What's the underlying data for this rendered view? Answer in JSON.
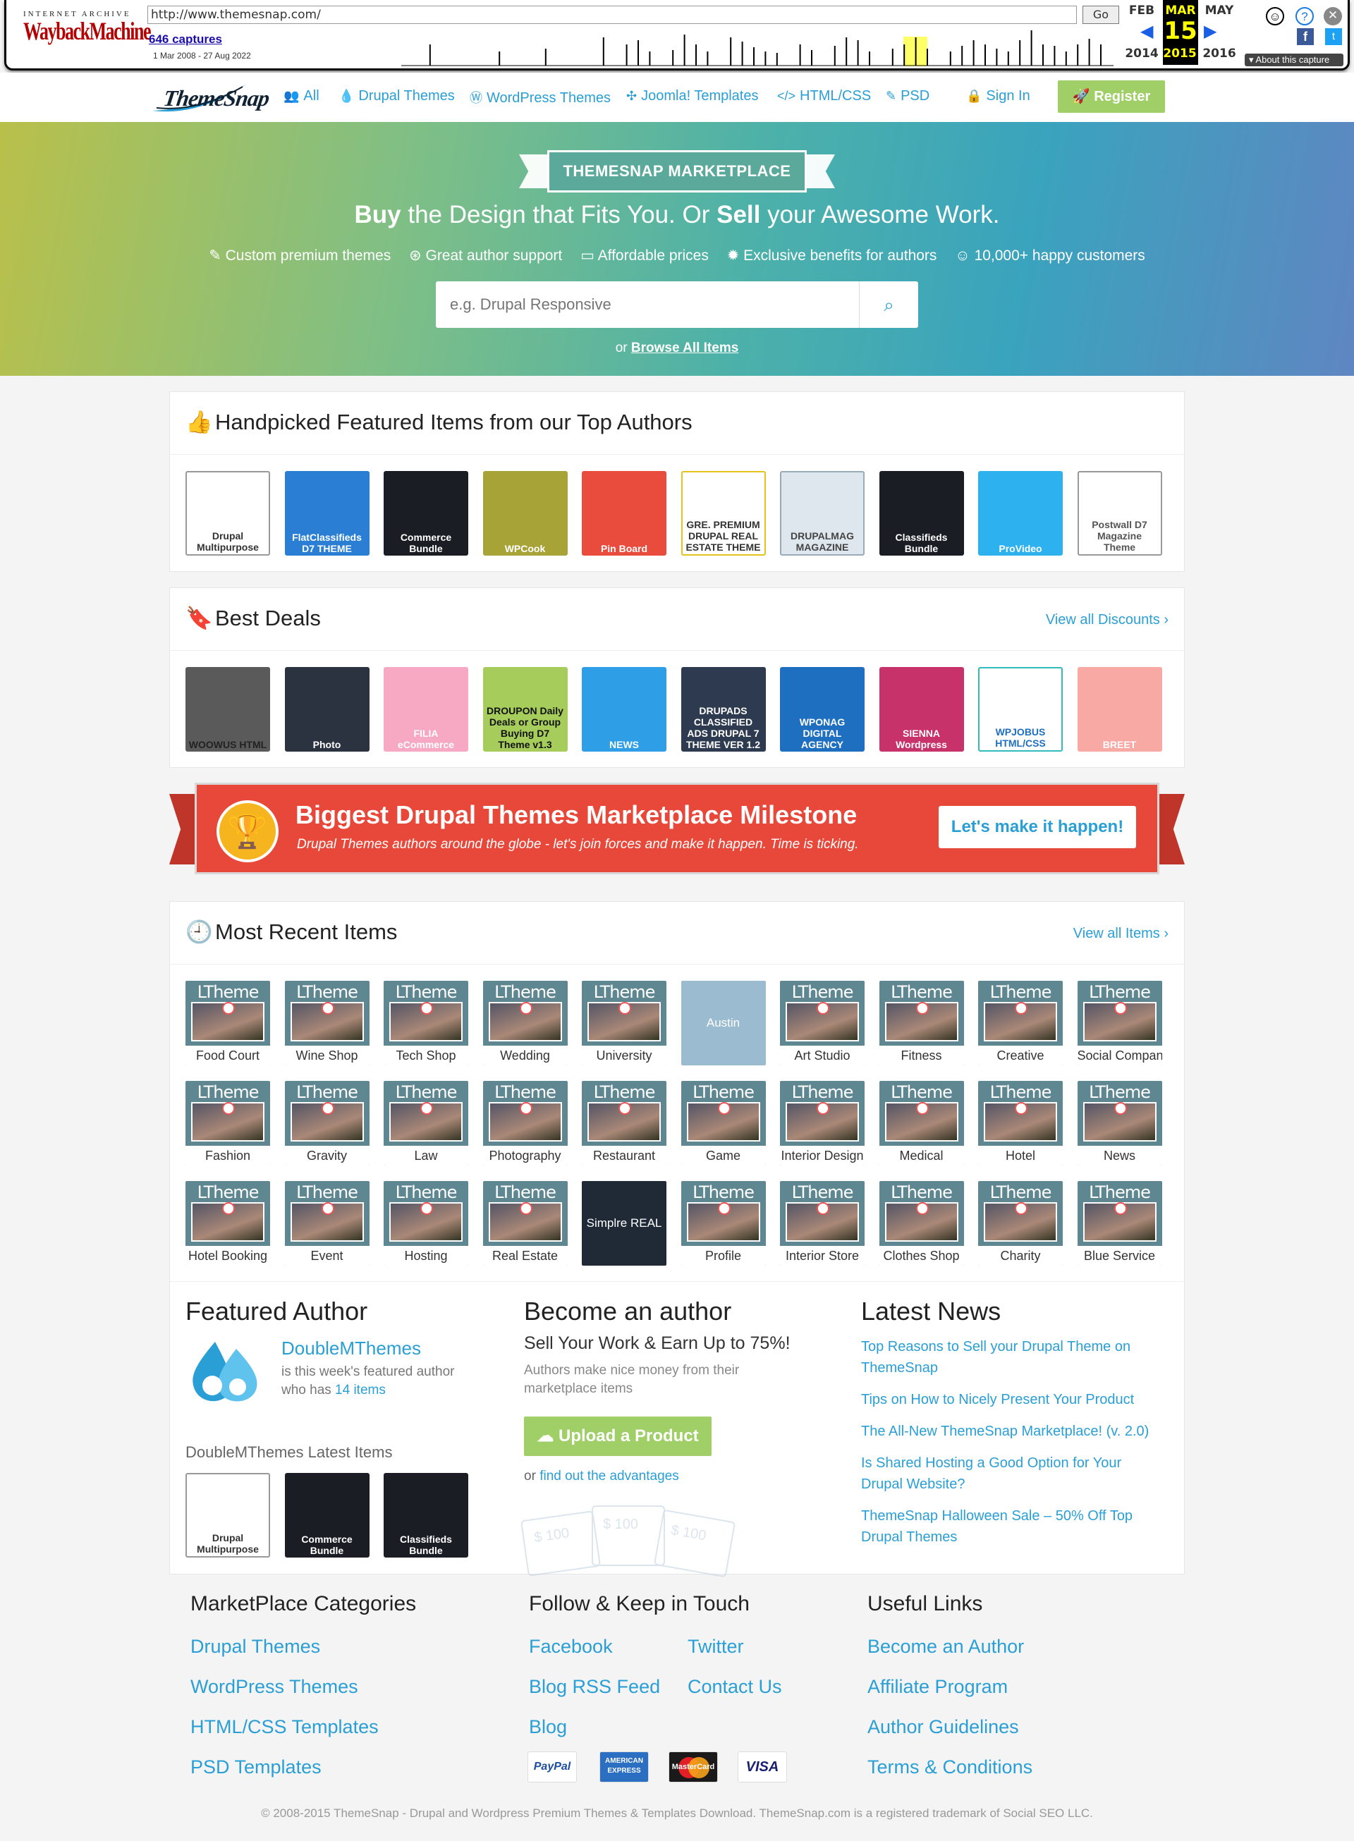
{
  "wayback": {
    "brand_top": "INTERNET ARCHIVE",
    "brand_main": "WaybackMachine",
    "url": "http://www.themesnap.com/",
    "go": "Go",
    "captures": "646 captures",
    "range": "1 Mar 2008 - 27 Aug 2022",
    "months": [
      "FEB",
      "MAR",
      "MAY"
    ],
    "day": "15",
    "years": [
      "2014",
      "2015",
      "2016"
    ],
    "about": "About this capture"
  },
  "nav": {
    "logo": "ThemeSnap",
    "items": [
      "All",
      "Drupal Themes",
      "WordPress Themes",
      "Joomla! Templates",
      "HTML/CSS",
      "PSD",
      "Sign In"
    ],
    "register": "Register"
  },
  "hero": {
    "banner": "THEMESNAP MARKETPLACE",
    "title_buy": "Buy",
    "title_mid": " the Design that Fits You. Or ",
    "title_sell": "Sell",
    "title_end": " your Awesome Work.",
    "features": [
      "Custom premium themes",
      "Great author support",
      "Affordable prices",
      "Exclusive benefits for authors",
      "10,000+ happy customers"
    ],
    "search_placeholder": "e.g. Drupal Responsive",
    "browse_or": "or ",
    "browse_link": "Browse All Items"
  },
  "featured": {
    "title": "Handpicked Featured Items from our Top Authors",
    "items": [
      "Drupal Multipurpose",
      "FlatClassifieds D7 THEME",
      "Commerce Bundle",
      "WPCook",
      "Pin Board",
      "GRE. PREMIUM DRUPAL REAL ESTATE THEME",
      "DRUPALMAG MAGAZINE",
      "Classifieds Bundle",
      "ProVideo",
      "Postwall D7 Magazine Theme"
    ]
  },
  "deals": {
    "title": "Best Deals",
    "link": "View all Discounts ›",
    "items": [
      "WOOWUS HTML",
      "Photo",
      "FILIA eCommerce",
      "DROUPON Daily Deals or Group Buying D7 Theme v1.3",
      "NEWS",
      "DRUPADS CLASSIFIED ADS DRUPAL 7 THEME VER 1.2",
      "WPONAG DIGITAL AGENCY",
      "SIENNA Wordpress",
      "WPJOBUS HTML/CSS",
      "BREET"
    ]
  },
  "milestone": {
    "title": "Biggest Drupal Themes Marketplace Milestone",
    "subtitle": "Drupal Themes authors around the globe - let's join forces and make it happen. Time is ticking.",
    "cta": "Let's make it happen!"
  },
  "recent": {
    "title": "Most Recent Items",
    "link": "View all Items ›",
    "brand": "LTheme",
    "rows": [
      [
        "Food Court",
        "Wine Shop",
        "Tech Shop",
        "Wedding",
        "University",
        "Austin",
        "Art Studio",
        "Fitness",
        "Creative",
        "Social Company"
      ],
      [
        "Fashion",
        "Gravity",
        "Law",
        "Photography",
        "Restaurant",
        "Game",
        "Interior Design",
        "Medical",
        "Hotel",
        "News"
      ],
      [
        "Hotel Booking",
        "Event",
        "Hosting",
        "Real Estate",
        "Simplre REAL ESTATE",
        "Profile",
        "Interior Store",
        "Clothes Shop",
        "Charity",
        "Blue Service"
      ]
    ]
  },
  "author": {
    "title": "Featured Author",
    "name": "DoubleMThemes",
    "desc1": "is this week's featured author",
    "desc2": "who has ",
    "count": "14 items",
    "latest": "DoubleMThemes Latest Items",
    "items": [
      "Drupal Multipurpose",
      "Commerce Bundle",
      "Classifieds Bundle"
    ]
  },
  "become": {
    "title": "Become an author",
    "sub": "Sell Your Work & Earn Up to 75%!",
    "desc": "Authors make nice money from their marketplace items",
    "upload": "Upload a Product",
    "or": "or ",
    "link": "find out the advantages",
    "notes": [
      "$ 100",
      "$ 100",
      "$ 100"
    ]
  },
  "news": {
    "title": "Latest News",
    "items": [
      "Top Reasons to Sell your Drupal Theme on ThemeSnap",
      "Tips on How to Nicely Present Your Product",
      "The All-New ThemeSnap Marketplace! (v. 2.0)",
      "Is Shared Hosting a Good Option for Your Drupal Website?",
      "ThemeSnap Halloween Sale – 50% Off Top Drupal Themes"
    ]
  },
  "footer": {
    "cat_title": "MarketPlace Categories",
    "cats": [
      "Drupal Themes",
      "WordPress Themes",
      "HTML/CSS Templates",
      "PSD Templates"
    ],
    "follow_title": "Follow & Keep in Touch",
    "follow": [
      "Facebook",
      "Twitter",
      "Blog RSS Feed",
      "Contact Us",
      "Blog"
    ],
    "useful_title": "Useful Links",
    "useful": [
      "Become an Author",
      "Affiliate Program",
      "Author Guidelines",
      "Terms & Conditions"
    ],
    "payments": [
      "PayPal",
      "AMERICAN EXPRESS",
      "MasterCard",
      "VISA"
    ],
    "copyright": "© 2008-2015 ThemeSnap - Drupal and Wordpress Premium Themes & Templates Download. ThemeSnap.com is a registered trademark of Social SEO LLC."
  }
}
